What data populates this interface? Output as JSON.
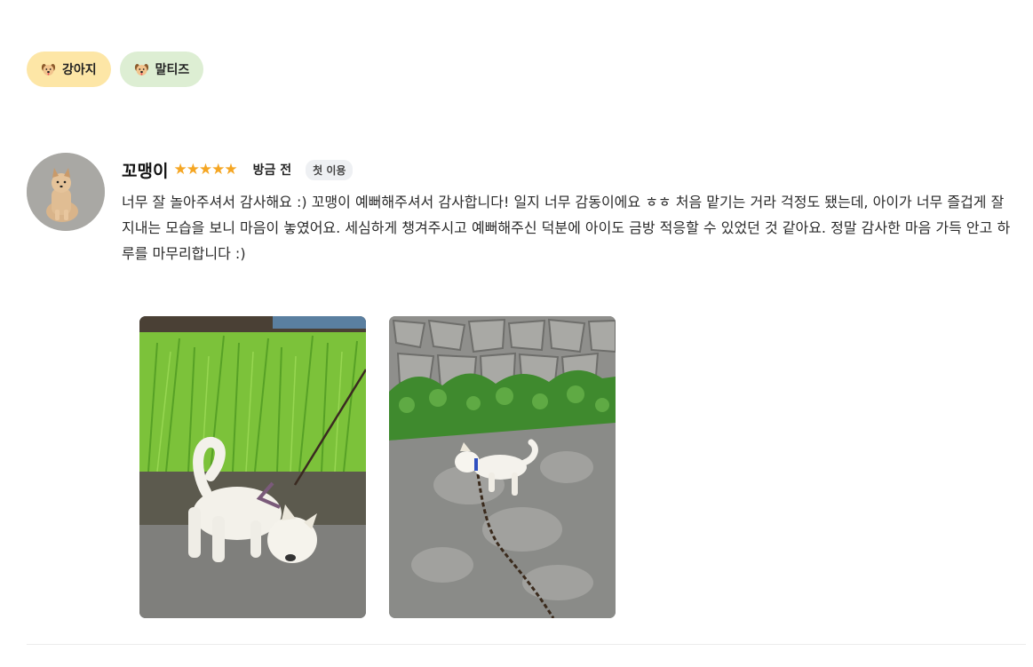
{
  "tags": [
    {
      "label": "강아지",
      "icon": "dog-face-icon",
      "bg": "#fde6a6"
    },
    {
      "label": "말티즈",
      "icon": "dog-face-icon",
      "bg": "#ddeed3"
    }
  ],
  "review": {
    "author": "꼬맹이",
    "rating": 5,
    "stars": "★★★★★",
    "time": "방금 전",
    "badge": "첫 이용",
    "text": "너무 잘 놀아주셔서 감사해요 :) 꼬맹이 예뻐해주셔서 감사합니다! 일지 너무 감동이에요 ㅎㅎ 처음 맡기는 거라 걱정도 됐는데, 아이가 너무 즐겁게 잘 지내는 모습을 보니 마음이 놓였어요. 세심하게 챙겨주시고 예뻐해주신 덕분에 아이도 금방 적응할 수 있었던 것 같아요. 정말 감사한 마음 가득 안고 하루를 마무리합니다 :)",
    "photos": [
      {
        "icon": "dog-in-grass-photo"
      },
      {
        "icon": "dog-on-pavement-photo"
      }
    ]
  },
  "colors": {
    "star": "#f5a623",
    "tag_dog": "#fde6a6",
    "tag_maltese": "#ddeed3"
  }
}
